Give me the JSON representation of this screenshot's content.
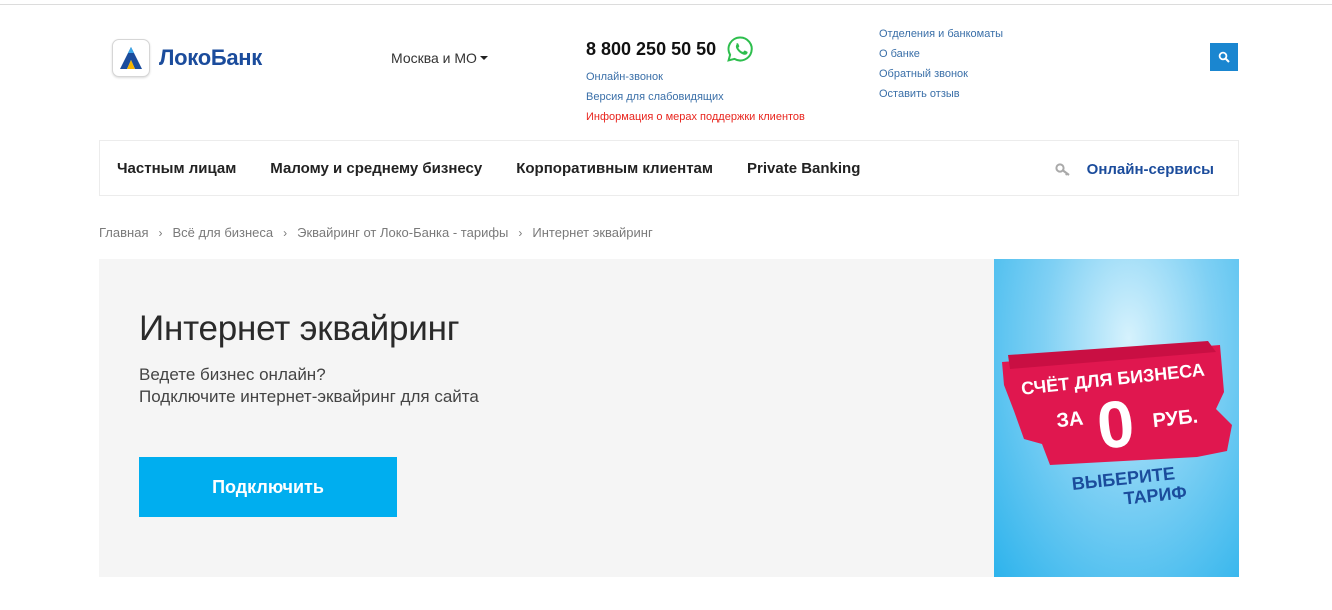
{
  "header": {
    "logo_text": "ЛокоБанк",
    "city": "Москва и МО",
    "phone": "8 800 250 50 50",
    "phone_links": [
      "Онлайн-звонок",
      "Версия для слабовидящих",
      "Информация о мерах поддержки клиентов"
    ],
    "side_links": [
      "Отделения и банкоматы",
      "О банке",
      "Обратный звонок",
      "Оставить отзыв"
    ],
    "search_icon": "search-icon",
    "whatsapp_icon": "whatsapp-icon"
  },
  "nav": {
    "items": [
      "Частным лицам",
      "Малому и среднему бизнесу",
      "Корпоративным клиентам",
      "Private Banking"
    ],
    "online_services": "Онлайн-сервисы"
  },
  "breadcrumb": [
    "Главная",
    "Всё для бизнеса",
    "Эквайринг от Локо-Банка - тарифы",
    "Интернет эквайринг"
  ],
  "hero": {
    "title": "Интернет эквайринг",
    "lead_line1": "Ведете бизнес онлайн?",
    "lead_line2": "Подключите интернет-эквайринг для сайта",
    "button": "Подключить"
  },
  "banner": {
    "line1": "СЧЁТ ДЛЯ БИЗНЕСА",
    "za": "ЗА",
    "zero": "0",
    "rub": "РУБ.",
    "line3": "ВЫБЕРИТЕ",
    "line4": "ТАРИФ"
  },
  "colors": {
    "brand_blue": "#1b4c9c",
    "link_blue": "#3a6fa8",
    "cta": "#00aeef",
    "alert_red": "#e8251e",
    "banner_pink": "#e0174f"
  }
}
